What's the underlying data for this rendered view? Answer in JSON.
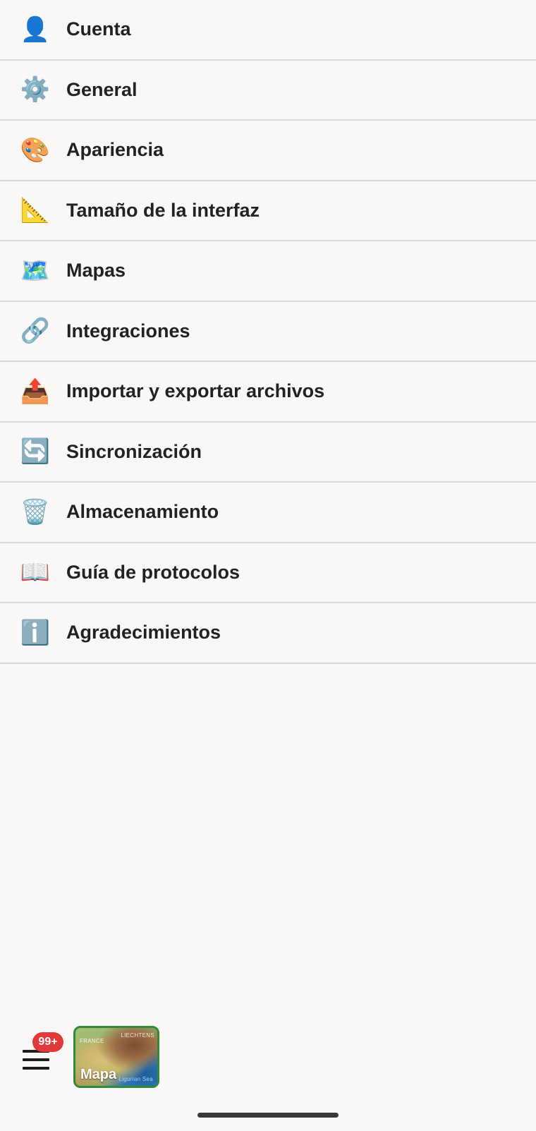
{
  "settings": {
    "items": [
      {
        "label": "Cuenta",
        "icon": "👤",
        "icon_name": "user-icon"
      },
      {
        "label": "General",
        "icon": "⚙️",
        "icon_name": "gear-icon"
      },
      {
        "label": "Apariencia",
        "icon": "🎨",
        "icon_name": "palette-icon"
      },
      {
        "label": "Tamaño de la interfaz",
        "icon": "📐",
        "icon_name": "ruler-icon"
      },
      {
        "label": "Mapas",
        "icon": "🗺️",
        "icon_name": "map-icon"
      },
      {
        "label": "Integraciones",
        "icon": "🔗",
        "icon_name": "link-icon"
      },
      {
        "label": "Importar y exportar archivos",
        "icon": "📤",
        "icon_name": "outbox-icon"
      },
      {
        "label": "Sincronización",
        "icon": "🔄",
        "icon_name": "sync-icon"
      },
      {
        "label": "Almacenamiento",
        "icon": "🗑️",
        "icon_name": "trash-icon"
      },
      {
        "label": "Guía de protocolos",
        "icon": "📖",
        "icon_name": "book-icon"
      },
      {
        "label": "Agradecimientos",
        "icon": "ℹ️",
        "icon_name": "info-icon"
      }
    ]
  },
  "bottom_bar": {
    "menu_icon": "hamburger-icon",
    "badge": "99+",
    "map_tile": {
      "label": "Mapa",
      "region_label_1": "FRANCE",
      "region_label_2": "LIECHTENS",
      "region_label_3": "Ligurian Sea"
    }
  },
  "colors": {
    "background": "#f9f8f6",
    "divider": "#d9d9d7",
    "badge": "#e23a3a",
    "map_border": "#2f8a3a",
    "text": "#222222"
  }
}
